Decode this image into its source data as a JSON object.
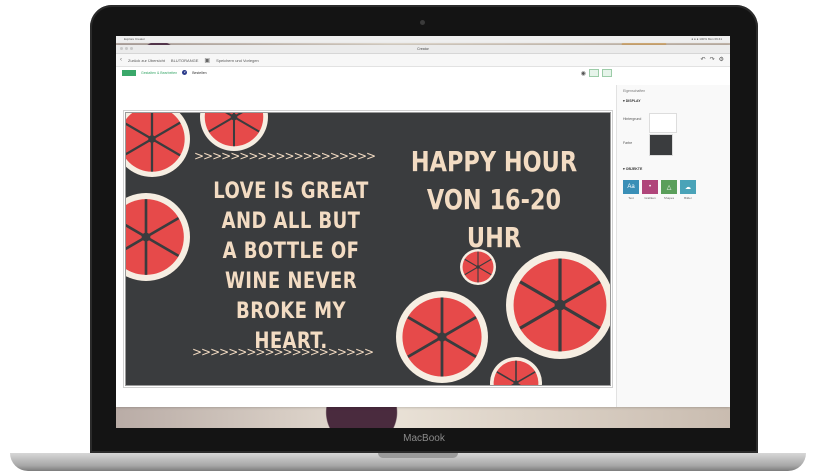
{
  "device": {
    "brand": "MacBook"
  },
  "menubar": {
    "app": "Explore Creator",
    "right": "● ● ●  100% Mon 09:41"
  },
  "window": {
    "title": "Creator"
  },
  "toolbar": {
    "items": [
      "Zurück zur Übersicht",
      "BLUTORANGE",
      "Speichern und Vorlegen"
    ],
    "right_icons": [
      "undo-icon",
      "redo-icon",
      "settings-icon"
    ]
  },
  "steps": {
    "step1": "Gestalten & Bearbeiten",
    "step2_num": "2",
    "step2": "Bestellen"
  },
  "canvas": {
    "left_text": [
      "LOVE IS GREAT",
      "AND ALL BUT",
      "A BOTTLE OF",
      "WINE NEVER",
      "BROKE MY HEART."
    ],
    "right_text": [
      "HAPPY HOUR",
      "VON 16-20 UHR"
    ],
    "arrow_top": ">>>>>>>>>>>>>>>>>>>>",
    "arrow_bottom": ">>>>>>>>>>>>>>>>>>>>"
  },
  "panel": {
    "header": "Eigenschaften",
    "section_display": "DISPLAY",
    "label_bg": "Hintergrund",
    "label_color": "Farbe",
    "section_objects": "OBJEKTE",
    "layers": [
      {
        "label": "Text",
        "glyph": "Aa",
        "color": "#3a8fb7"
      },
      {
        "label": "Grafiken",
        "glyph": "•",
        "color": "#b0457a"
      },
      {
        "label": "Shapes",
        "glyph": "△",
        "color": "#5a9e5a"
      },
      {
        "label": "Bilder",
        "glyph": "☁",
        "color": "#4aa3b8"
      }
    ]
  },
  "colors": {
    "canvas_bg": "#3a3c3e",
    "text": "#f3dcc3",
    "fruit_red": "#e64a4a",
    "accent_green": "#3aa86a"
  }
}
